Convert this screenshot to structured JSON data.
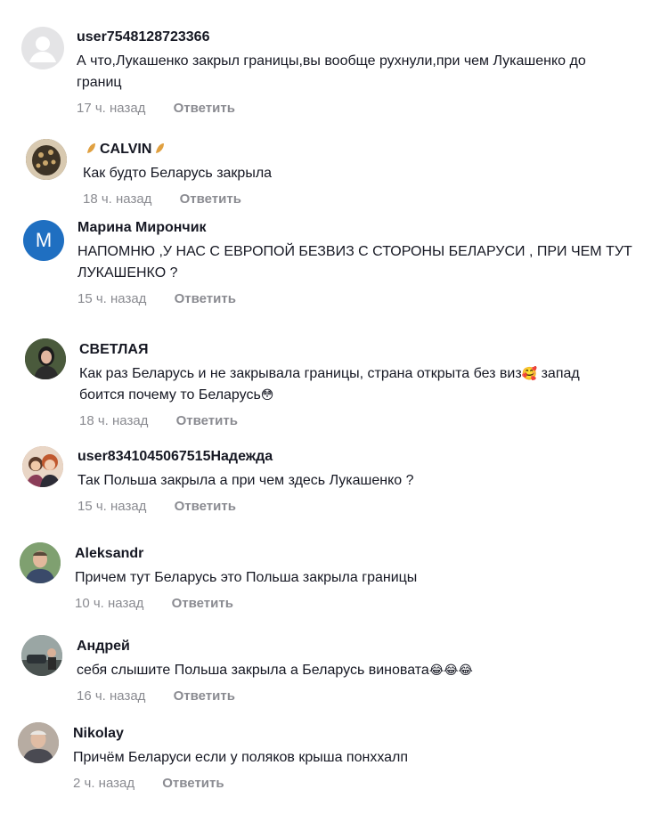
{
  "comments": [
    {
      "user": "user7548128723366",
      "text": "А что,Лукашенко закрыл границы,вы вообще рухнули,при чем Лукашенко до границ",
      "time": "17 ч. назад",
      "reply": "Ответить",
      "avatar_color": "#e4e4e6"
    },
    {
      "user": "CALVIN",
      "user_decoration": "leaf-icon",
      "text": "Как будто Беларусь закрыла",
      "time": "18 ч. назад",
      "reply": "Ответить",
      "avatar_color": "#6b5a3a"
    },
    {
      "user": "Марина Мирончик",
      "avatar_letter": "M",
      "text": "НАПОМНЮ ,У НАС С ЕВРОПОЙ БЕЗВИЗ С СТОРОНЫ БЕЛАРУСИ , ПРИ ЧЕМ ТУТ ЛУКАШЕНКО ?",
      "time": "15 ч. назад",
      "reply": "Ответить",
      "avatar_color": "#1f6fc1"
    },
    {
      "user": "СВЕТЛАЯ",
      "text_part1": "Как раз Беларусь и не закрывала границы, страна открыта без виз",
      "emoji1": "🥰",
      "text_part2": " запад боится почему то Беларусь",
      "emoji2": "😳",
      "time": "18 ч. назад",
      "reply": "Ответить",
      "avatar_color": "#3a3f35"
    },
    {
      "user": "user8341045067515Надежда",
      "text": "Так Польша закрыла а при чем здесь Лукашенко ?",
      "time": "15 ч. назад",
      "reply": "Ответить",
      "avatar_color": "#b8876a"
    },
    {
      "user": "Aleksandr",
      "text": "Причем тут Беларусь это Польша закрыла границы",
      "time": "10 ч. назад",
      "reply": "Ответить",
      "avatar_color": "#6f8f6a"
    },
    {
      "user": "Андрей",
      "text": "себя слышите Польша закрыла а Беларусь виновата",
      "emoji": "😂😂😂",
      "time": "16 ч. назад",
      "reply": "Ответить",
      "avatar_color": "#7c8a8e"
    },
    {
      "user": "Nikolay",
      "text": "Причём Беларуси если у поляков крыша понххалп",
      "time": "2 ч. назад",
      "reply": "Ответить",
      "avatar_color": "#9a8f86"
    }
  ]
}
